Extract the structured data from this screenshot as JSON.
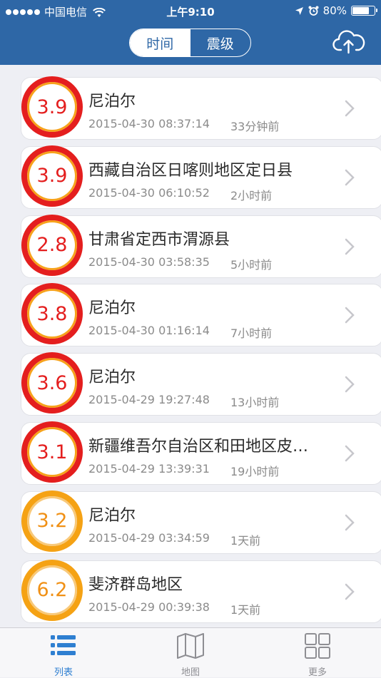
{
  "status_bar": {
    "carrier": "中国电信",
    "time": "上午9:10",
    "battery": "80%",
    "battery_level": 0.8
  },
  "header": {
    "tabs": [
      {
        "label": "时间",
        "active": true
      },
      {
        "label": "震级",
        "active": false
      }
    ],
    "upload_icon": "cloud-upload-icon"
  },
  "quakes": [
    {
      "magnitude": "3.9",
      "level": "red",
      "place": "尼泊尔",
      "datetime": "2015-04-30 08:37:14",
      "ago": "33分钟前"
    },
    {
      "magnitude": "3.9",
      "level": "red",
      "place": "西藏自治区日喀则地区定日县",
      "datetime": "2015-04-30 06:10:52",
      "ago": "2小时前"
    },
    {
      "magnitude": "2.8",
      "level": "red",
      "place": "甘肃省定西市渭源县",
      "datetime": "2015-04-30 03:58:35",
      "ago": "5小时前"
    },
    {
      "magnitude": "3.8",
      "level": "red",
      "place": "尼泊尔",
      "datetime": "2015-04-30 01:16:14",
      "ago": "7小时前"
    },
    {
      "magnitude": "3.6",
      "level": "red",
      "place": "尼泊尔",
      "datetime": "2015-04-29 19:27:48",
      "ago": "13小时前"
    },
    {
      "magnitude": "3.1",
      "level": "red",
      "place": "新疆维吾尔自治区和田地区皮…",
      "datetime": "2015-04-29 13:39:31",
      "ago": "19小时前"
    },
    {
      "magnitude": "3.2",
      "level": "orange",
      "place": "尼泊尔",
      "datetime": "2015-04-29 03:34:59",
      "ago": "1天前"
    },
    {
      "magnitude": "6.2",
      "level": "orange",
      "place": "斐济群岛地区",
      "datetime": "2015-04-29 00:39:38",
      "ago": "1天前"
    }
  ],
  "tabbar": {
    "items": [
      {
        "label": "列表",
        "icon": "list-icon",
        "active": true
      },
      {
        "label": "地图",
        "icon": "map-icon",
        "active": false
      },
      {
        "label": "更多",
        "icon": "grid-icon",
        "active": false
      }
    ]
  },
  "colors": {
    "header": "#2e67a6",
    "red": "#e41e1e",
    "orange": "#f5a214",
    "active_tab": "#2e7fd1"
  }
}
